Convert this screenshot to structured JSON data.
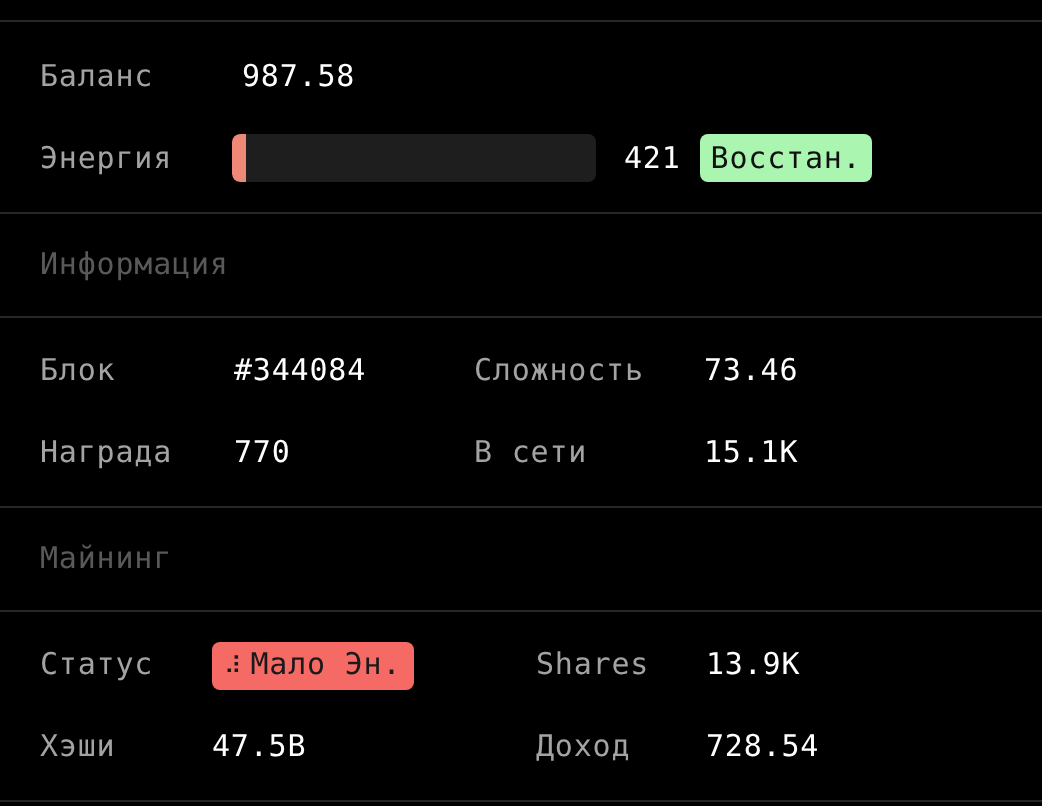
{
  "sections": [
    {
      "kind": "account",
      "balance_label": "Баланс",
      "balance": "987.58",
      "energy_label": "Энергия",
      "energy": {
        "level": 0.04,
        "reading": "421",
        "action": "Восстан."
      }
    },
    {
      "kind": "grid",
      "title": "Информация",
      "rows": [
        [
          {
            "label": "Блок",
            "value": "#344084"
          },
          {
            "label": "Сложность",
            "value": "73.46"
          }
        ],
        [
          {
            "label": "Награда",
            "value": "770"
          },
          {
            "label": "В сети",
            "value": "15.1K"
          }
        ]
      ]
    },
    {
      "kind": "grid",
      "title": "Майнинг",
      "rows": [
        [
          {
            "label": "Статус",
            "value": "Мало Эн.",
            "badge": true,
            "spinner": "⠼"
          },
          {
            "label": "Shares",
            "value": "13.9K"
          }
        ],
        [
          {
            "label": "Хэши",
            "value": "47.5B"
          },
          {
            "label": "Доход",
            "value": "728.54"
          }
        ]
      ]
    }
  ]
}
